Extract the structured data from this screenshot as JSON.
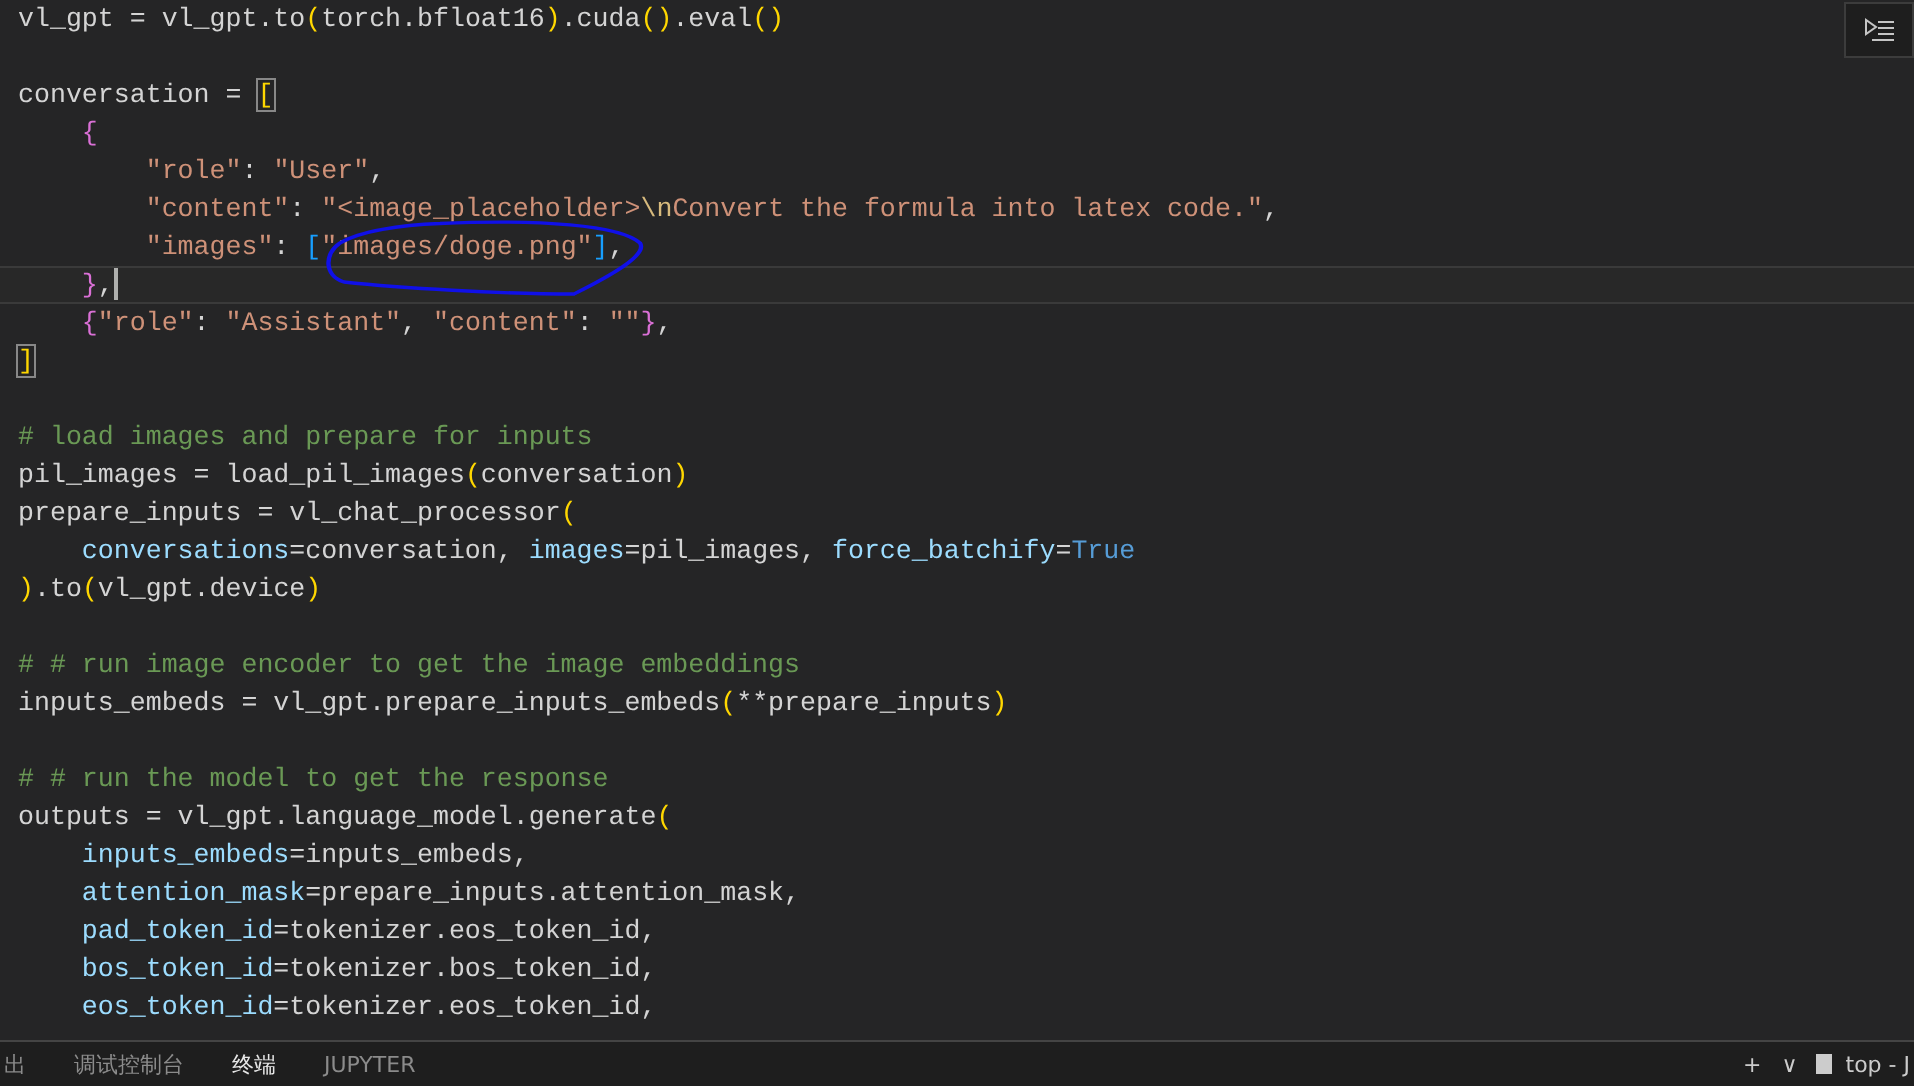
{
  "editor": {
    "lines": [
      {
        "current": false,
        "tokens": [
          {
            "t": "vl_gpt = vl_gpt.to",
            "kind": "plain"
          },
          {
            "t": "(",
            "kind": "b1"
          },
          {
            "t": "torch.bfloat16",
            "kind": "plain"
          },
          {
            "t": ")",
            "kind": "b1"
          },
          {
            "t": ".cuda",
            "kind": "plain"
          },
          {
            "t": "()",
            "kind": "b1"
          },
          {
            "t": ".eval",
            "kind": "plain"
          },
          {
            "t": "()",
            "kind": "b1"
          }
        ]
      },
      {
        "current": false
      },
      {
        "current": false,
        "tokens": [
          {
            "t": "conversation = ",
            "kind": "plain"
          },
          {
            "t": "[",
            "kind": "b1",
            "matched": true
          }
        ]
      },
      {
        "current": false,
        "tokens": [
          {
            "t": "    {",
            "kind": "b2"
          }
        ]
      },
      {
        "current": false,
        "tokens": [
          {
            "t": "        \"role\"",
            "kind": "str"
          },
          {
            "t": ": ",
            "kind": "plain"
          },
          {
            "t": "\"User\"",
            "kind": "str"
          },
          {
            "t": ",",
            "kind": "plain"
          }
        ]
      },
      {
        "current": false,
        "tokens": [
          {
            "t": "        \"content\"",
            "kind": "str"
          },
          {
            "t": ": ",
            "kind": "plain"
          },
          {
            "t": "\"<image_placeholder>",
            "kind": "str"
          },
          {
            "t": "\\n",
            "kind": "esc"
          },
          {
            "t": "Convert the formula into latex code.\"",
            "kind": "str"
          },
          {
            "t": ",",
            "kind": "plain"
          }
        ]
      },
      {
        "current": false,
        "tokens": [
          {
            "t": "        \"images\"",
            "kind": "str"
          },
          {
            "t": ": ",
            "kind": "plain"
          },
          {
            "t": "[",
            "kind": "b3"
          },
          {
            "t": "\"images/doge.png\"",
            "kind": "str"
          },
          {
            "t": "]",
            "kind": "b3"
          },
          {
            "t": ",",
            "kind": "plain"
          }
        ]
      },
      {
        "current": true,
        "tokens": [
          {
            "t": "    }",
            "kind": "b2"
          },
          {
            "t": ",",
            "kind": "plain"
          }
        ]
      },
      {
        "current": false,
        "tokens": [
          {
            "t": "    {",
            "kind": "b2"
          },
          {
            "t": "\"role\"",
            "kind": "str"
          },
          {
            "t": ": ",
            "kind": "plain"
          },
          {
            "t": "\"Assistant\"",
            "kind": "str"
          },
          {
            "t": ", ",
            "kind": "plain"
          },
          {
            "t": "\"content\"",
            "kind": "str"
          },
          {
            "t": ": ",
            "kind": "plain"
          },
          {
            "t": "\"\"",
            "kind": "str"
          },
          {
            "t": "}",
            "kind": "b2"
          },
          {
            "t": ",",
            "kind": "plain"
          }
        ]
      },
      {
        "current": false,
        "tokens": [
          {
            "t": "]",
            "kind": "b1",
            "matched": true
          }
        ]
      },
      {
        "current": false
      },
      {
        "current": false,
        "tokens": [
          {
            "t": "# load images and prepare for inputs",
            "kind": "comment"
          }
        ]
      },
      {
        "current": false,
        "tokens": [
          {
            "t": "pil_images = load_pil_images",
            "kind": "plain"
          },
          {
            "t": "(",
            "kind": "b1"
          },
          {
            "t": "conversation",
            "kind": "plain"
          },
          {
            "t": ")",
            "kind": "b1"
          }
        ]
      },
      {
        "current": false,
        "tokens": [
          {
            "t": "prepare_inputs = vl_chat_processor",
            "kind": "plain"
          },
          {
            "t": "(",
            "kind": "b1"
          }
        ]
      },
      {
        "current": false,
        "tokens": [
          {
            "t": "    conversations",
            "kind": "param"
          },
          {
            "t": "=conversation, ",
            "kind": "plain"
          },
          {
            "t": "images",
            "kind": "param"
          },
          {
            "t": "=pil_images, ",
            "kind": "plain"
          },
          {
            "t": "force_batchify",
            "kind": "param"
          },
          {
            "t": "=",
            "kind": "plain"
          },
          {
            "t": "True",
            "kind": "kw"
          }
        ]
      },
      {
        "current": false,
        "tokens": [
          {
            "t": ")",
            "kind": "b1"
          },
          {
            "t": ".to",
            "kind": "plain"
          },
          {
            "t": "(",
            "kind": "b1"
          },
          {
            "t": "vl_gpt.device",
            "kind": "plain"
          },
          {
            "t": ")",
            "kind": "b1"
          }
        ]
      },
      {
        "current": false
      },
      {
        "current": false,
        "tokens": [
          {
            "t": "# # run image encoder to get the image embeddings",
            "kind": "comment"
          }
        ]
      },
      {
        "current": false,
        "tokens": [
          {
            "t": "inputs_embeds = vl_gpt.prepare_inputs_embeds",
            "kind": "plain"
          },
          {
            "t": "(",
            "kind": "b1"
          },
          {
            "t": "**prepare_inputs",
            "kind": "plain"
          },
          {
            "t": ")",
            "kind": "b1"
          }
        ]
      },
      {
        "current": false
      },
      {
        "current": false,
        "tokens": [
          {
            "t": "# # run the model to get the response",
            "kind": "comment"
          }
        ]
      },
      {
        "current": false,
        "tokens": [
          {
            "t": "outputs = vl_gpt.language_model.generate",
            "kind": "plain"
          },
          {
            "t": "(",
            "kind": "b1"
          }
        ]
      },
      {
        "current": false,
        "tokens": [
          {
            "t": "    inputs_embeds",
            "kind": "param"
          },
          {
            "t": "=inputs_embeds,",
            "kind": "plain"
          }
        ]
      },
      {
        "current": false,
        "tokens": [
          {
            "t": "    attention_mask",
            "kind": "param"
          },
          {
            "t": "=prepare_inputs.attention_mask,",
            "kind": "plain"
          }
        ]
      },
      {
        "current": false,
        "tokens": [
          {
            "t": "    pad_token_id",
            "kind": "param"
          },
          {
            "t": "=tokenizer.eos_token_id,",
            "kind": "plain"
          }
        ]
      },
      {
        "current": false,
        "tokens": [
          {
            "t": "    bos_token_id",
            "kind": "param"
          },
          {
            "t": "=tokenizer.bos_token_id,",
            "kind": "plain"
          }
        ]
      },
      {
        "current": false,
        "tokens": [
          {
            "t": "    eos_token_id",
            "kind": "param"
          },
          {
            "t": "=tokenizer.eos_token_id,",
            "kind": "plain"
          }
        ]
      }
    ]
  },
  "panel": {
    "tabs": [
      {
        "label": "出",
        "selected": false
      },
      {
        "label": "调试控制台",
        "selected": false
      },
      {
        "label": "终端",
        "selected": true
      },
      {
        "label": "JUPYTER",
        "selected": false
      }
    ],
    "actions": [
      "+",
      "∨"
    ],
    "terminal_label": "top - J"
  }
}
